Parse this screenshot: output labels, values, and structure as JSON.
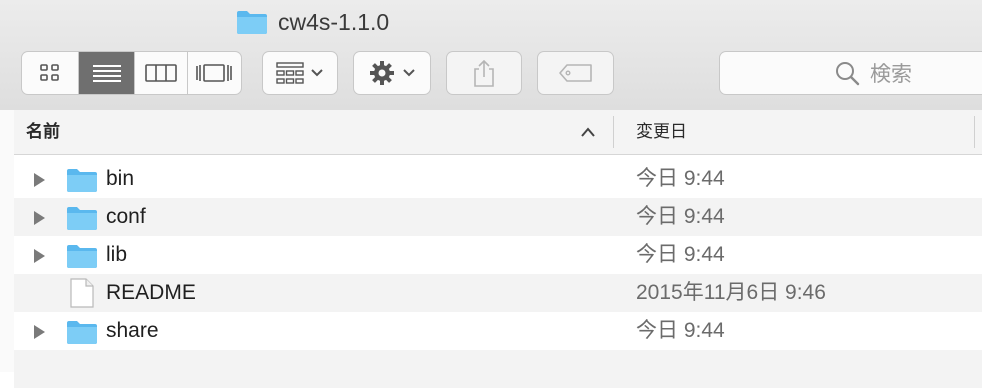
{
  "window": {
    "title": "cw4s-1.1.0",
    "title_icon": "folder-icon"
  },
  "toolbar": {
    "view_modes": [
      {
        "icon": "icon-view-icon",
        "active": false
      },
      {
        "icon": "list-view-icon",
        "active": true
      },
      {
        "icon": "column-view-icon",
        "active": false
      },
      {
        "icon": "coverflow-view-icon",
        "active": false
      }
    ],
    "arrange_icon": "arrange-icon",
    "action_icon": "gear-icon",
    "share_icon": "share-icon",
    "tag_icon": "tag-icon",
    "search_placeholder": "検索"
  },
  "columns": {
    "name": "名前",
    "date": "変更日"
  },
  "files": [
    {
      "name": "bin",
      "date": "今日 9:44",
      "type": "folder"
    },
    {
      "name": "conf",
      "date": "今日 9:44",
      "type": "folder"
    },
    {
      "name": "lib",
      "date": "今日 9:44",
      "type": "folder"
    },
    {
      "name": "README",
      "date": "2015年11月6日 9:46",
      "type": "file"
    },
    {
      "name": "share",
      "date": "今日 9:44",
      "type": "folder"
    }
  ],
  "colors": {
    "folder": "#6cc2f2",
    "active_segment": "#6f6f6f"
  }
}
